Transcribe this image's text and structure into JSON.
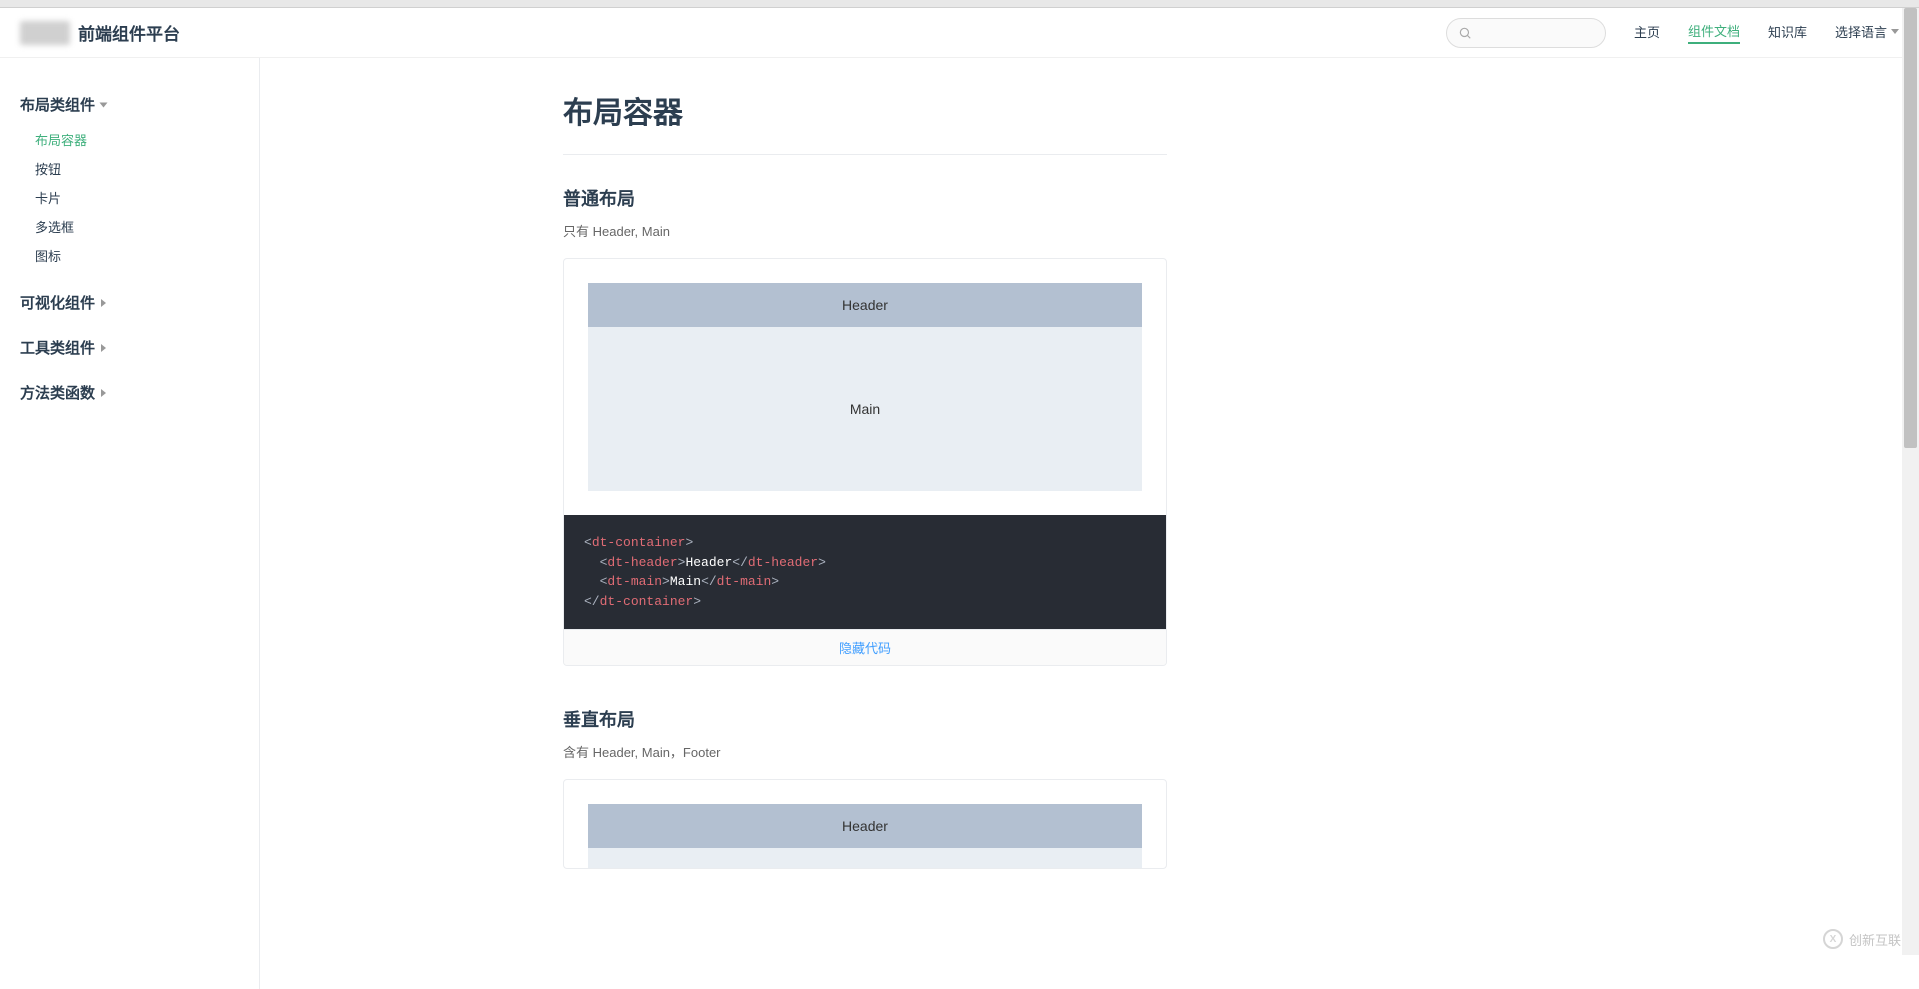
{
  "header": {
    "site_title": "前端组件平台",
    "search_placeholder": "",
    "nav": [
      {
        "label": "主页",
        "active": false
      },
      {
        "label": "组件文档",
        "active": true
      },
      {
        "label": "知识库",
        "active": false
      }
    ],
    "lang_label": "选择语言"
  },
  "sidebar": {
    "groups": [
      {
        "title": "布局类组件",
        "expanded": true,
        "items": [
          "布局容器",
          "按钮",
          "卡片",
          "多选框",
          "图标"
        ],
        "active_item": "布局容器"
      },
      {
        "title": "可视化组件",
        "expanded": false
      },
      {
        "title": "工具类组件",
        "expanded": false
      },
      {
        "title": "方法类函数",
        "expanded": false
      }
    ]
  },
  "main": {
    "page_title": "布局容器",
    "sections": [
      {
        "title": "普通布局",
        "desc": "只有 Header, Main",
        "demo": {
          "header_text": "Header",
          "main_text": "Main"
        },
        "code_lines": [
          [
            {
              "t": "punc",
              "v": "<"
            },
            {
              "t": "tag",
              "v": "dt-container"
            },
            {
              "t": "punc",
              "v": ">"
            }
          ],
          [
            {
              "t": "indent",
              "v": "  "
            },
            {
              "t": "punc",
              "v": "<"
            },
            {
              "t": "tag",
              "v": "dt-header"
            },
            {
              "t": "punc",
              "v": ">"
            },
            {
              "t": "text",
              "v": "Header"
            },
            {
              "t": "punc",
              "v": "</"
            },
            {
              "t": "tag",
              "v": "dt-header"
            },
            {
              "t": "punc",
              "v": ">"
            }
          ],
          [
            {
              "t": "indent",
              "v": "  "
            },
            {
              "t": "punc",
              "v": "<"
            },
            {
              "t": "tag",
              "v": "dt-main"
            },
            {
              "t": "punc",
              "v": ">"
            },
            {
              "t": "text",
              "v": "Main"
            },
            {
              "t": "punc",
              "v": "</"
            },
            {
              "t": "tag",
              "v": "dt-main"
            },
            {
              "t": "punc",
              "v": ">"
            }
          ],
          [
            {
              "t": "punc",
              "v": "</"
            },
            {
              "t": "tag",
              "v": "dt-container"
            },
            {
              "t": "punc",
              "v": ">"
            }
          ]
        ],
        "toggle_label": "隐藏代码"
      },
      {
        "title": "垂直布局",
        "desc": "含有 Header, Main，Footer",
        "demo": {
          "header_text": "Header"
        }
      }
    ]
  },
  "watermark": "创新互联"
}
